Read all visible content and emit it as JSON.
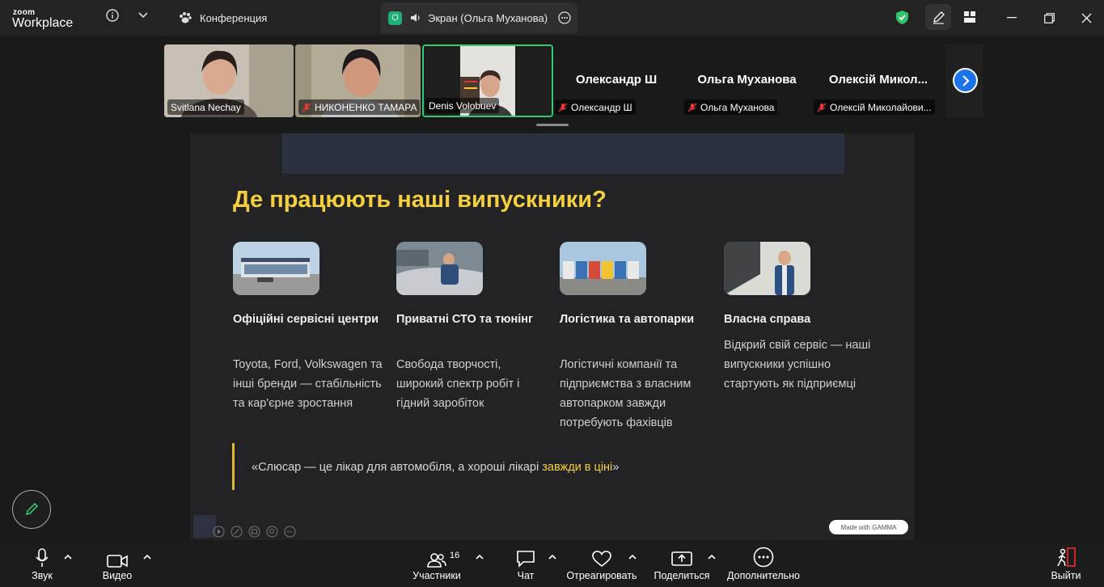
{
  "app": {
    "logo_small": "zoom",
    "logo_big": "Workplace"
  },
  "tabs": {
    "meeting": {
      "label": "Конференция"
    },
    "share": {
      "label": "Экран (Ольга Муханова)",
      "badge": "О"
    }
  },
  "participants": [
    {
      "name": "Svitlana Nechay",
      "muted": false,
      "video": true
    },
    {
      "name": "НИКОНЕНКО ТАМАРА",
      "muted": true,
      "video": true
    },
    {
      "name": "Denis Volobuev",
      "muted": false,
      "video": true,
      "active": true
    },
    {
      "name": "Олександр Ш",
      "display": "Олександр Ш",
      "muted": true,
      "video": false
    },
    {
      "name": "Ольга Муханова",
      "display": "Ольга Муханова",
      "muted": true,
      "video": false
    },
    {
      "name": "Олексій Миколайови...",
      "display": "Олексій  Микол...",
      "muted": true,
      "video": false
    }
  ],
  "slide": {
    "title": "Де працюють наші випускники?",
    "columns": [
      {
        "heading": "Офіційні сервісні центри",
        "text": "Toyota, Ford, Volkswagen та інші бренди — стабільність та кар'єрне зростання"
      },
      {
        "heading": "Приватні СТО та тюнінг",
        "text": "Свобода творчості, широкий спектр робіт і гідний заробіток"
      },
      {
        "heading": "Логістика та автопарки",
        "text": "Логістичні компанії та підприємства з власним автопарком завжди потребують фахівців"
      },
      {
        "heading": "Власна справа",
        "text": "Відкрий свій сервіс — наші випускники успішно стартують як підприємці"
      }
    ],
    "quote_main": "«Слюсар — це лікар для автомобіля, а хороші лікарі ",
    "quote_highlight": "завжди в ціні",
    "quote_end": "»",
    "badge": "Made with GAMMA"
  },
  "toolbar": {
    "audio": "Звук",
    "video": "Видео",
    "participants": "Участники",
    "participants_count": "16",
    "chat": "Чат",
    "react": "Отреагировать",
    "share": "Поделиться",
    "more": "Дополнительно",
    "leave": "Выйти"
  },
  "colors": {
    "accent": "#f4d03f",
    "active_border": "#2fcc71",
    "next_button": "#1a73e8",
    "leave": "#e02828"
  }
}
